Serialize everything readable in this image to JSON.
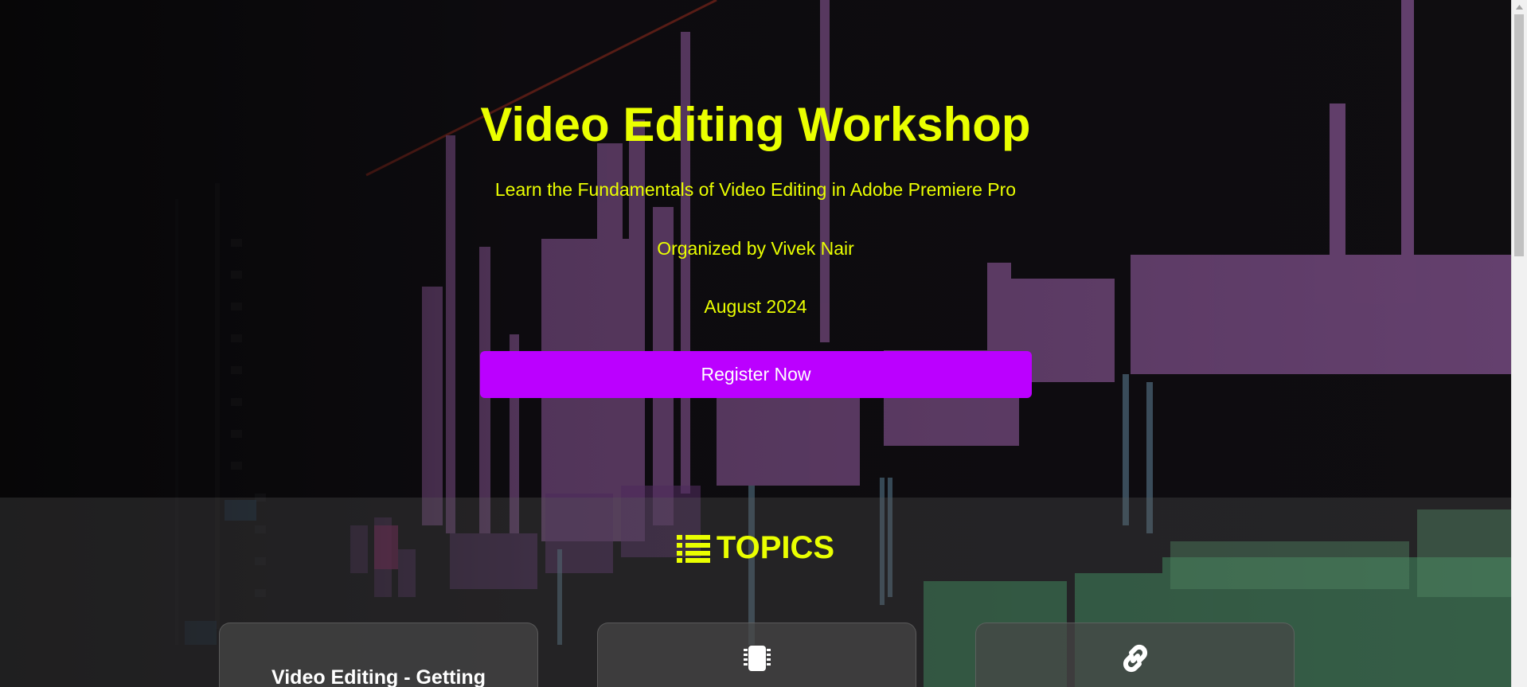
{
  "hero": {
    "title": "Video Editing Workshop",
    "subtitle": "Learn the Fundamentals of Video Editing in Adobe Premiere Pro",
    "organizer": "Organized by Vivek Nair",
    "date": "August 2024",
    "register_label": "Register Now"
  },
  "topics": {
    "heading": "TOPICS",
    "heading_icon": "list-icon",
    "cards": [
      {
        "title": "Video Editing - Getting",
        "icon": ""
      },
      {
        "title": "",
        "icon": "chip-icon"
      },
      {
        "title": "",
        "icon": "link-icon"
      }
    ]
  },
  "colors": {
    "accent_text": "#eaff00",
    "button": "#bb00ff",
    "card_bg": "#464646"
  }
}
